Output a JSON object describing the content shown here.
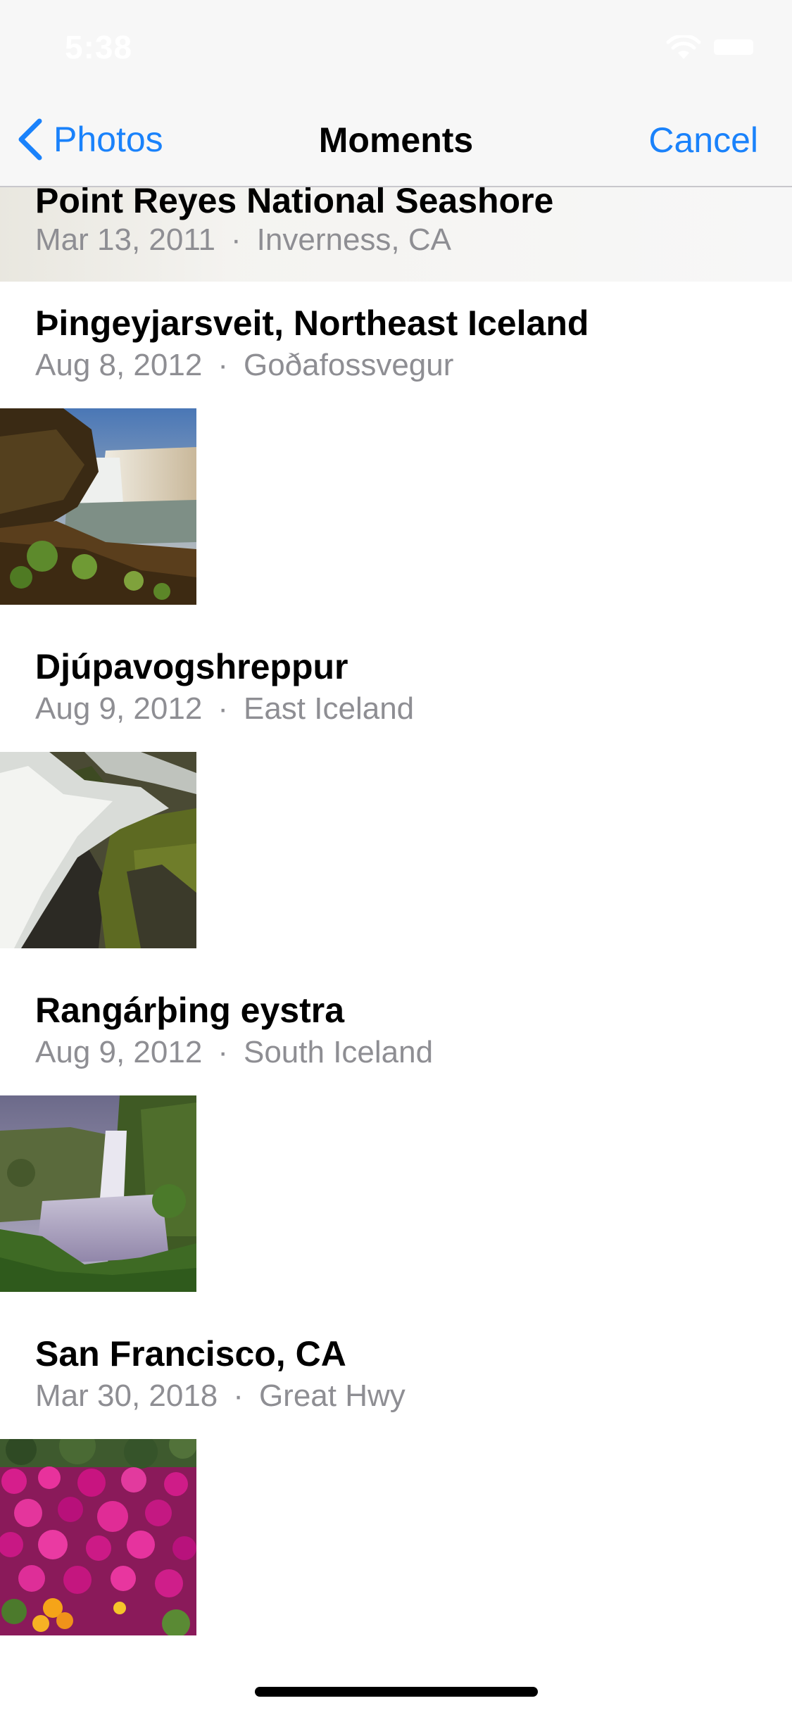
{
  "status_bar": {
    "time": "5:38"
  },
  "nav": {
    "back_label": "Photos",
    "title": "Moments",
    "cancel_label": "Cancel"
  },
  "moments": [
    {
      "title": "Point Reyes National Seashore",
      "date": "Mar 13, 2011",
      "location": "Inverness, CA",
      "separator": "·"
    },
    {
      "title": "Þingeyjarsveit, Northeast Iceland",
      "date": "Aug 8, 2012",
      "location": "Goðafossvegur",
      "separator": "·",
      "photo": "waterfall-cliff-photo"
    },
    {
      "title": "Djúpavogshreppur",
      "date": "Aug 9, 2012",
      "location": "East Iceland",
      "separator": "·",
      "photo": "waterfall-rocks-photo"
    },
    {
      "title": "Rangárþing eystra",
      "date": "Aug 9, 2012",
      "location": "South Iceland",
      "separator": "·",
      "photo": "misty-waterfall-photo"
    },
    {
      "title": "San Francisco, CA",
      "date": "Mar 30, 2018",
      "location": "Great Hwy",
      "separator": "·",
      "photo": "pink-flowers-photo"
    }
  ],
  "colors": {
    "accent": "#1a82fb",
    "secondary_text": "#8e8e93",
    "nav_background": "#f7f7f7"
  }
}
